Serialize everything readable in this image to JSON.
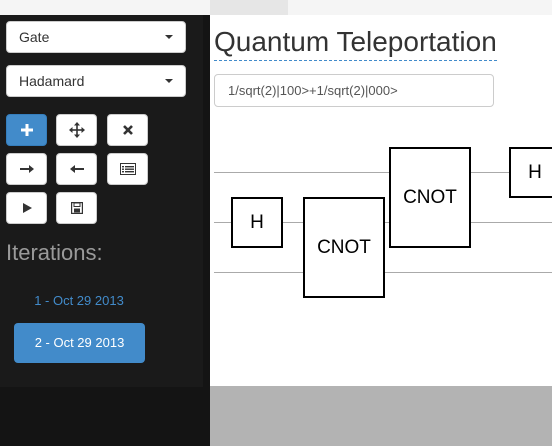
{
  "sidebar": {
    "gate_select": "Gate",
    "gate_type_select": "Hadamard",
    "toolbar": {
      "add": "plus-icon",
      "move": "move-icon",
      "delete": "close-icon",
      "right": "arrow-right-icon",
      "left": "arrow-left-icon",
      "list": "list-icon",
      "play": "play-icon",
      "save": "save-icon"
    },
    "iterations_title": "Iterations:",
    "iterations": [
      {
        "label": "1 - Oct 29 2013",
        "active": false
      },
      {
        "label": "2 - Oct 29 2013",
        "active": true
      }
    ]
  },
  "main": {
    "title": "Quantum Teleportation",
    "state_value": "1/sqrt(2)|100>+1/sqrt(2)|000>",
    "gates": [
      {
        "label": "H"
      },
      {
        "label": "CNOT"
      },
      {
        "label": "CNOT"
      },
      {
        "label": "H"
      }
    ]
  },
  "colors": {
    "accent": "#428bca",
    "sidebar": "#1a1a1a",
    "canvas_bg": "#b3b3b3"
  }
}
